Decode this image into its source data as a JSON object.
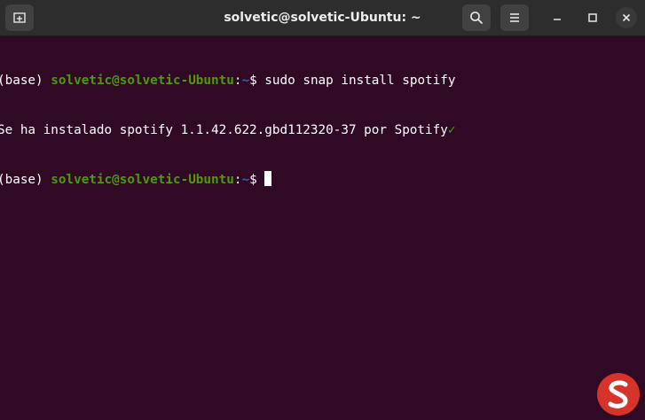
{
  "window": {
    "title": "solvetic@solvetic-Ubuntu: ~"
  },
  "titlebar": {
    "new_tab_icon": "new-tab-icon",
    "search_icon": "search-icon",
    "menu_icon": "hamburger-menu-icon",
    "minimize_icon": "minimize-icon",
    "maximize_icon": "maximize-icon",
    "close_icon": "close-icon"
  },
  "terminal": {
    "colors": {
      "background": "#300a24",
      "text": "#ffffff",
      "user_host": "#4e9a06",
      "path": "#3465a4"
    },
    "lines": [
      {
        "env": "(base) ",
        "user_host": "solvetic@solvetic-Ubuntu",
        "sep": ":",
        "path": "~",
        "symbol": "$ ",
        "command": "sudo snap install spotify"
      },
      {
        "output": "Se ha instalado spotify 1.1.42.622.gbd112320-37 por Spotify",
        "verified_mark": "✓"
      },
      {
        "env": "(base) ",
        "user_host": "solvetic@solvetic-Ubuntu",
        "sep": ":",
        "path": "~",
        "symbol": "$ ",
        "command": ""
      }
    ]
  },
  "watermark": {
    "logo": "solvetic-logo"
  }
}
